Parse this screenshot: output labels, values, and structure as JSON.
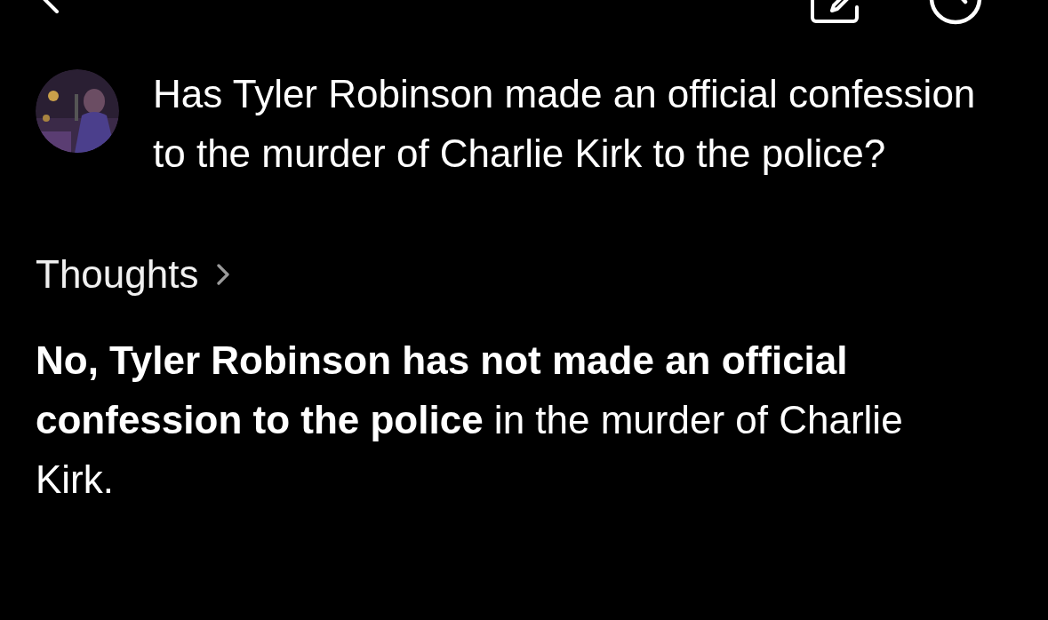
{
  "question": {
    "text": "Has Tyler Robinson made an official confession to the murder of Charlie Kirk to the police?"
  },
  "thoughts": {
    "label": "Thoughts",
    "expanded": false
  },
  "answer": {
    "text": "**No, Tyler Robinson has not made an official confession to the police** in the murder of Charlie Kirk."
  }
}
